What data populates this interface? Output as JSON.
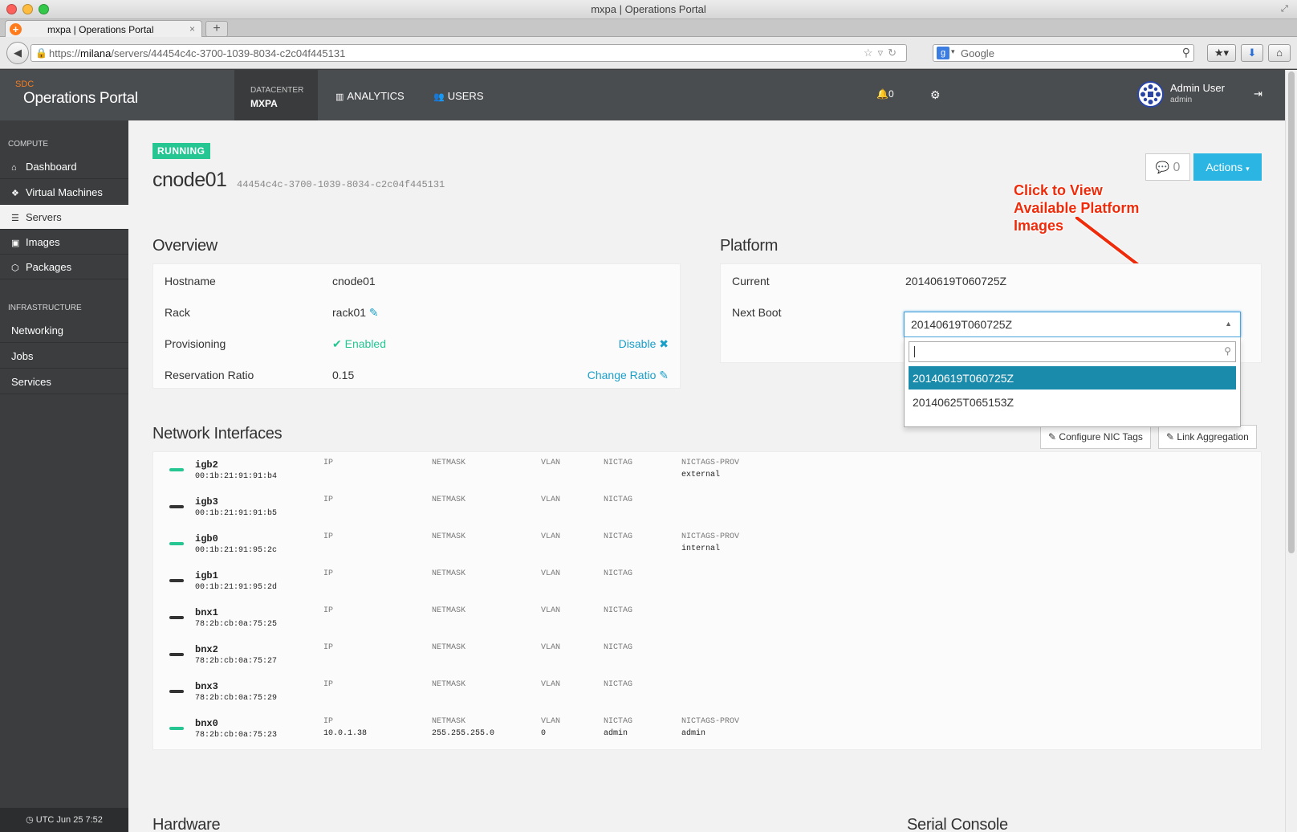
{
  "window": {
    "title": "mxpa | Operations Portal"
  },
  "browser": {
    "tab_label": "mxpa | Operations Portal",
    "tab_close": "×",
    "new_tab": "+",
    "url_prefix": "https://",
    "url_host": "milana",
    "url_path": "/servers/44454c4c-3700-1039-8034-c2c04f445131",
    "search_engine_placeholder": "Google"
  },
  "header": {
    "brand_sub": "SDC",
    "brand_main": "Operations Portal",
    "datacenter_label": "DATACENTER",
    "datacenter_value": "MXPA",
    "nav": [
      {
        "label": "ANALYTICS",
        "icon": "bar-chart-icon"
      },
      {
        "label": "USERS",
        "icon": "users-icon"
      }
    ],
    "notifications_count": "0",
    "user_name": "Admin User",
    "user_login": "admin"
  },
  "sidebar": {
    "compute_title": "COMPUTE",
    "compute_items": [
      {
        "label": "Dashboard",
        "icon": "home-icon"
      },
      {
        "label": "Virtual Machines",
        "icon": "cubes-icon"
      },
      {
        "label": "Servers",
        "icon": "list-icon",
        "selected": true
      },
      {
        "label": "Images",
        "icon": "image-icon"
      },
      {
        "label": "Packages",
        "icon": "package-icon"
      }
    ],
    "infra_title": "INFRASTRUCTURE",
    "infra_items": [
      {
        "label": "Networking"
      },
      {
        "label": "Jobs"
      },
      {
        "label": "Services"
      }
    ],
    "footer_time": "UTC Jun 25 7:52"
  },
  "server": {
    "status": "RUNNING",
    "name": "cnode01",
    "uuid": "44454c4c-3700-1039-8034-c2c04f445131",
    "comments_count": "0",
    "actions_label": "Actions"
  },
  "annotation": {
    "line1": "Click to View",
    "line2": "Available Platform",
    "line3": "Images"
  },
  "overview": {
    "title": "Overview",
    "rows": [
      {
        "label": "Hostname",
        "value": "cnode01"
      },
      {
        "label": "Rack",
        "value": "rack01"
      },
      {
        "label": "Provisioning",
        "value": "Enabled",
        "action": "Disable"
      },
      {
        "label": "Reservation Ratio",
        "value": "0.15",
        "action": "Change Ratio"
      }
    ]
  },
  "platform": {
    "title": "Platform",
    "current_label": "Current",
    "current_value": "20140619T060725Z",
    "next_boot_label": "Next Boot",
    "next_boot_selected": "20140619T060725Z",
    "options": [
      "20140619T060725Z",
      "20140625T065153Z"
    ]
  },
  "network": {
    "title": "Network Interfaces",
    "configure_btn": "Configure NIC Tags",
    "link_agg_btn": "Link Aggregation",
    "headers": {
      "ip": "IP",
      "netmask": "NETMASK",
      "vlan": "VLAN",
      "nictag": "NICTAG",
      "nictags_prov": "NICTAGS-PROV"
    },
    "interfaces": [
      {
        "name": "igb2",
        "mac": "00:1b:21:91:91:b4",
        "up": true,
        "ip": "",
        "netmask": "",
        "vlan": "",
        "nictag": "",
        "prov_header": "NICTAGS-PROV",
        "prov": "external"
      },
      {
        "name": "igb3",
        "mac": "00:1b:21:91:91:b5",
        "up": false,
        "ip": "",
        "netmask": "",
        "vlan": "",
        "nictag": "",
        "prov_header": "",
        "prov": ""
      },
      {
        "name": "igb0",
        "mac": "00:1b:21:91:95:2c",
        "up": true,
        "ip": "",
        "netmask": "",
        "vlan": "",
        "nictag": "",
        "prov_header": "NICTAGS-PROV",
        "prov": "internal"
      },
      {
        "name": "igb1",
        "mac": "00:1b:21:91:95:2d",
        "up": false,
        "ip": "",
        "netmask": "",
        "vlan": "",
        "nictag": "",
        "prov_header": "",
        "prov": ""
      },
      {
        "name": "bnx1",
        "mac": "78:2b:cb:0a:75:25",
        "up": false,
        "ip": "",
        "netmask": "",
        "vlan": "",
        "nictag": "",
        "prov_header": "",
        "prov": ""
      },
      {
        "name": "bnx2",
        "mac": "78:2b:cb:0a:75:27",
        "up": false,
        "ip": "",
        "netmask": "",
        "vlan": "",
        "nictag": "",
        "prov_header": "",
        "prov": ""
      },
      {
        "name": "bnx3",
        "mac": "78:2b:cb:0a:75:29",
        "up": false,
        "ip": "",
        "netmask": "",
        "vlan": "",
        "nictag": "",
        "prov_header": "",
        "prov": ""
      },
      {
        "name": "bnx0",
        "mac": "78:2b:cb:0a:75:23",
        "up": true,
        "ip": "10.0.1.38",
        "netmask": "255.255.255.0",
        "vlan": "0",
        "nictag": "admin",
        "prov_header": "NICTAGS-PROV",
        "prov": "admin"
      }
    ]
  },
  "hardware": {
    "title": "Hardware"
  },
  "serial_console": {
    "title": "Serial Console"
  },
  "colors": {
    "accent": "#2bb5e2",
    "running": "#25c692",
    "link": "#1a9fc9",
    "selected_option": "#1b8bab",
    "annotation": "#ee2b0b",
    "brand_sub": "#f37c20"
  }
}
